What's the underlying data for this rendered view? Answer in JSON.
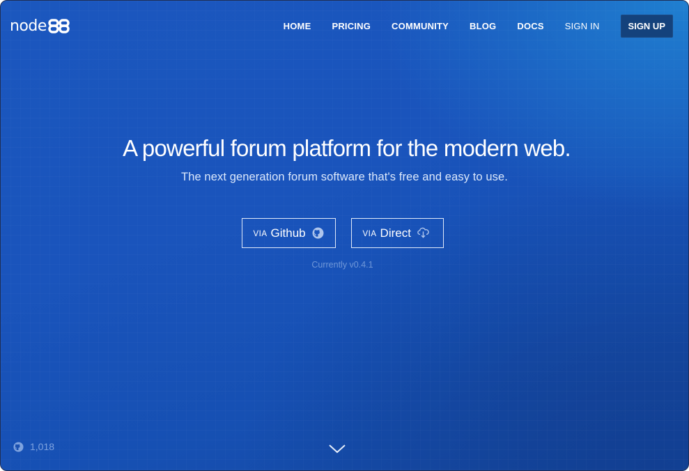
{
  "brand": {
    "name": "node",
    "mark": "BB"
  },
  "nav": {
    "items": [
      {
        "label": "HOME"
      },
      {
        "label": "PRICING"
      },
      {
        "label": "COMMUNITY"
      },
      {
        "label": "BLOG"
      },
      {
        "label": "DOCS"
      }
    ],
    "signin_label": "SIGN IN",
    "signup_label": "SIGN UP"
  },
  "hero": {
    "title": "A powerful forum platform for the modern web.",
    "subtitle": "The next generation forum software that's free and easy to use."
  },
  "downloads": {
    "github": {
      "prefix": "VIA",
      "label": "Github",
      "icon": "github-icon"
    },
    "direct": {
      "prefix": "VIA",
      "label": "Direct",
      "icon": "cloud-download-icon"
    },
    "version_text": "Currently v0.4.1"
  },
  "footer": {
    "stars_count": "1,018",
    "stars_icon": "github-icon",
    "scroll_icon": "chevron-down-icon"
  },
  "colors": {
    "background": "#1a54bc",
    "accent_dark": "#14427c",
    "muted_text": "#6f97d8"
  }
}
